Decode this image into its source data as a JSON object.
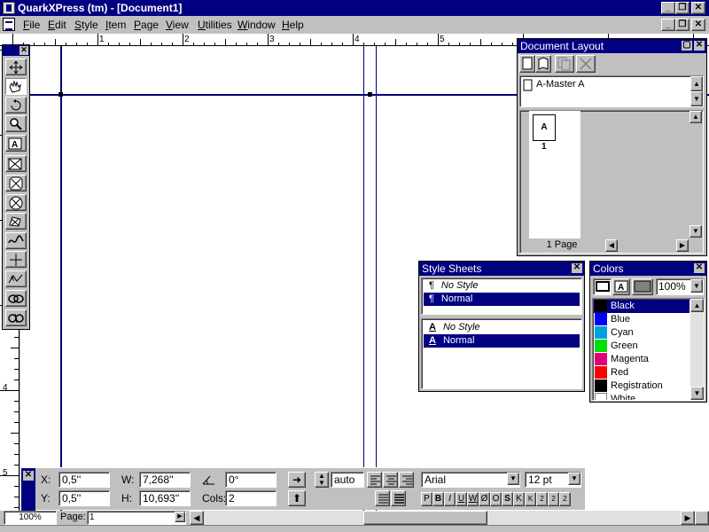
{
  "window": {
    "title": "QuarkXPress (tm) - [Document1]",
    "minimize_glyph": "_",
    "restore_glyph": "❐",
    "close_glyph": "✕"
  },
  "menu": [
    "File",
    "Edit",
    "Style",
    "Item",
    "Page",
    "View",
    "Utilities",
    "Window",
    "Help"
  ],
  "rulers": {
    "horizontal": [
      "1",
      "2",
      "3",
      "4",
      "5"
    ],
    "vertical": [
      "4",
      "5"
    ]
  },
  "tools": [
    "item-tool-icon",
    "content-tool-icon",
    "rotation-tool-icon",
    "zoom-tool-icon",
    "text-box-tool-icon",
    "picture-box-tool-icon",
    "oval-picture-box-tool-icon",
    "circle-picture-box-tool-icon",
    "bezier-picture-box-tool-icon",
    "line-tool-icon",
    "orthogonal-line-tool-icon",
    "text-path-tool-icon",
    "linking-tool-icon",
    "unlinking-tool-icon"
  ],
  "document_layout": {
    "title": "Document Layout",
    "master": "A-Master A",
    "page_thumb_label": "A",
    "page_number": "1",
    "page_count": "1 Page"
  },
  "style_sheets": {
    "title": "Style Sheets",
    "paragraph": [
      "No Style",
      "Normal"
    ],
    "character": [
      "No Style",
      "Normal"
    ]
  },
  "colors": {
    "title": "Colors",
    "zoom": "100%",
    "items": [
      {
        "name": "Black",
        "hex": "#000000"
      },
      {
        "name": "Blue",
        "hex": "#0000ff"
      },
      {
        "name": "Cyan",
        "hex": "#00a0e0"
      },
      {
        "name": "Green",
        "hex": "#00e000"
      },
      {
        "name": "Magenta",
        "hex": "#e0007a"
      },
      {
        "name": "Red",
        "hex": "#ff0000"
      },
      {
        "name": "Registration",
        "hex": "#000000"
      },
      {
        "name": "White",
        "hex": "#ffffff"
      }
    ]
  },
  "measurements": {
    "x_label": "X:",
    "x": "0,5''",
    "y_label": "Y:",
    "y": "0,5''",
    "w_label": "W:",
    "w": "7,268''",
    "h_label": "H:",
    "h": "10,693''",
    "angle": "0°",
    "cols_label": "Cols:",
    "cols": "2",
    "leading": "auto",
    "font": "Arial",
    "size": "12 pt",
    "type_styles": [
      "P",
      "B",
      "I",
      "U",
      "W",
      "Ø",
      "O",
      "S",
      "K",
      "K",
      "2",
      "2",
      "2"
    ]
  },
  "status": {
    "zoom": "100%",
    "page_label": "Page:",
    "page_value": "1"
  }
}
